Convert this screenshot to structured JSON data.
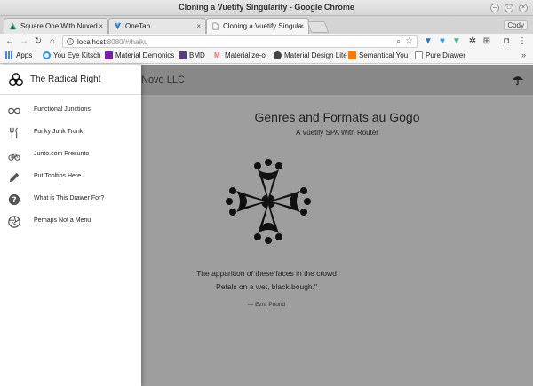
{
  "window": {
    "title": "Cloning a Vuetify Singularity - Google Chrome",
    "user": "Cody"
  },
  "tabs": [
    {
      "label": "Square One With Nuxed",
      "active": false
    },
    {
      "label": "OneTab",
      "active": false
    },
    {
      "label": "Cloning a Vuetify Singula",
      "active": true
    }
  ],
  "omnibox": {
    "host": "localhost",
    "path": ":8080/#/haiku"
  },
  "bookmarks": [
    {
      "label": "Apps",
      "icon": "apps-grid-icon"
    },
    {
      "label": "You Eye Kitsch",
      "icon": "swirl-icon"
    },
    {
      "label": "Material Demonics",
      "icon": "purple-square-icon"
    },
    {
      "label": "BMD",
      "icon": "bootstrap-icon"
    },
    {
      "label": "Materialize-o",
      "icon": "materialize-icon"
    },
    {
      "label": "Material Design Lite",
      "icon": "mdl-icon"
    },
    {
      "label": "Semantical You",
      "icon": "semantic-icon"
    },
    {
      "label": "Pure Drawer",
      "icon": "page-icon"
    }
  ],
  "app": {
    "toolbar_title": "Novo LLC",
    "headline": "Genres and Formats au Gogo",
    "subheading": "A Vuetify SPA With Router",
    "poem_line_1": "The apparition of these faces in the crowd",
    "poem_line_2": "Petals on a wet, black bough.\"",
    "author": "— Ezra Pound"
  },
  "drawer": {
    "title": "The Radical Right",
    "items": [
      {
        "label": "Functional Junctions",
        "icon": "infinity-icon"
      },
      {
        "label": "Funky Junk Trunk",
        "icon": "fork-knife-icon"
      },
      {
        "label": "Junto.com Presunto",
        "icon": "bicycle-icon"
      },
      {
        "label": "Put Tooltips Here",
        "icon": "pencil-icon"
      },
      {
        "label": "What is This Drawer For?",
        "icon": "help-circle-icon"
      },
      {
        "label": "Perhaps Not a Menu",
        "icon": "aperture-icon"
      }
    ]
  },
  "colors": {
    "overlay": "#9e9e9e",
    "app_toolbar": "#888888",
    "drawer_bg": "#ffffff",
    "vuetify_green": "#41b883"
  }
}
